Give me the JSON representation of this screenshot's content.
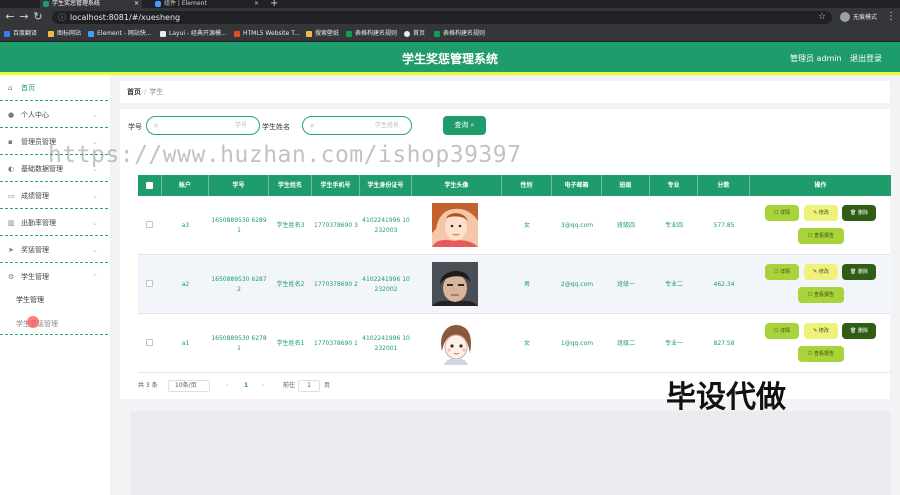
{
  "browser": {
    "tabs": [
      {
        "title": "学生奖惩管理系统",
        "active": true
      },
      {
        "title": "组件 | Element",
        "active": false
      }
    ],
    "new_tab": "+",
    "url": "localhost:8081/#/xuesheng",
    "profile": "无痕模式",
    "bookmarks": [
      "百度翻译",
      "图标网站",
      "Element - 网站快...",
      "Layui - 经典开源模...",
      "HTML5 Website T...",
      "搜索壁纸",
      "表格构建名规则",
      "首页",
      "表格构建名规则"
    ],
    "colors": {
      "tab_bar": "#202124",
      "toolbar": "#35363a"
    }
  },
  "header": {
    "title": "学生奖惩管理系统",
    "user": "管理员 admin",
    "logout": "退出登录",
    "colors": {
      "bg": "#1e9c6b",
      "accent": "#e6ff3a"
    }
  },
  "sidebar": {
    "items": [
      {
        "label": "首页",
        "icon": "home-icon"
      },
      {
        "label": "个人中心",
        "icon": "user-icon"
      },
      {
        "label": "管理员管理",
        "icon": "admin-icon"
      },
      {
        "label": "基础数据管理",
        "icon": "database-icon"
      },
      {
        "label": "成绩管理",
        "icon": "score-icon"
      },
      {
        "label": "出勤率管理",
        "icon": "chart-icon"
      },
      {
        "label": "奖惩管理",
        "icon": "send-icon"
      },
      {
        "label": "学生管理",
        "icon": "student-icon"
      }
    ],
    "subitems": [
      "学生管理",
      "学生奖惩管理"
    ]
  },
  "breadcrumb": {
    "home": "首页",
    "separator": "/",
    "current": "学生"
  },
  "search": {
    "field1_label": "学号",
    "field1_placeholder": "学号",
    "field2_label": "学生姓名",
    "field2_placeholder": "学生姓名",
    "button": "查询"
  },
  "table": {
    "headers": [
      "账户",
      "学号",
      "学生姓名",
      "学生手机号",
      "学生身份证号",
      "学生头像",
      "性别",
      "电子邮箱",
      "班级",
      "专业",
      "分数",
      "操作"
    ],
    "rows": [
      {
        "account": "a3",
        "student_no": "1650889530 62891",
        "name": "学生姓名3",
        "phone": "1770378690 3",
        "id_card": "4102241996 10232003",
        "gender": "女",
        "email": "3@qq.com",
        "class": "班级四",
        "major": "专业四",
        "score": "577.85"
      },
      {
        "account": "a2",
        "student_no": "1650889530 62872",
        "name": "学生姓名2",
        "phone": "1770378690 2",
        "id_card": "4102241996 10232002",
        "gender": "男",
        "email": "2@qq.com",
        "class": "班级一",
        "major": "专业二",
        "score": "462.34"
      },
      {
        "account": "a1",
        "student_no": "1650889530 62781",
        "name": "学生姓名1",
        "phone": "1770378690 1",
        "id_card": "4102241996 10232001",
        "gender": "女",
        "email": "1@qq.com",
        "class": "班级二",
        "major": "专业一",
        "score": "827.58"
      }
    ],
    "actions": {
      "detail": "详情",
      "edit": "修改",
      "delete": "删除",
      "report": "查看报告"
    },
    "colors": {
      "header": "#1e9c6b",
      "text": "#1e9c6b"
    }
  },
  "pagination": {
    "total": "共 3 条",
    "page_size": "10条/页",
    "prev": "‹",
    "current": "1",
    "next": "›",
    "goto_label": "前往",
    "goto_value": "1",
    "goto_unit": "页"
  },
  "watermarks": {
    "url": "https://www.huzhan.com/ishop39397",
    "promo": "毕设代做"
  }
}
